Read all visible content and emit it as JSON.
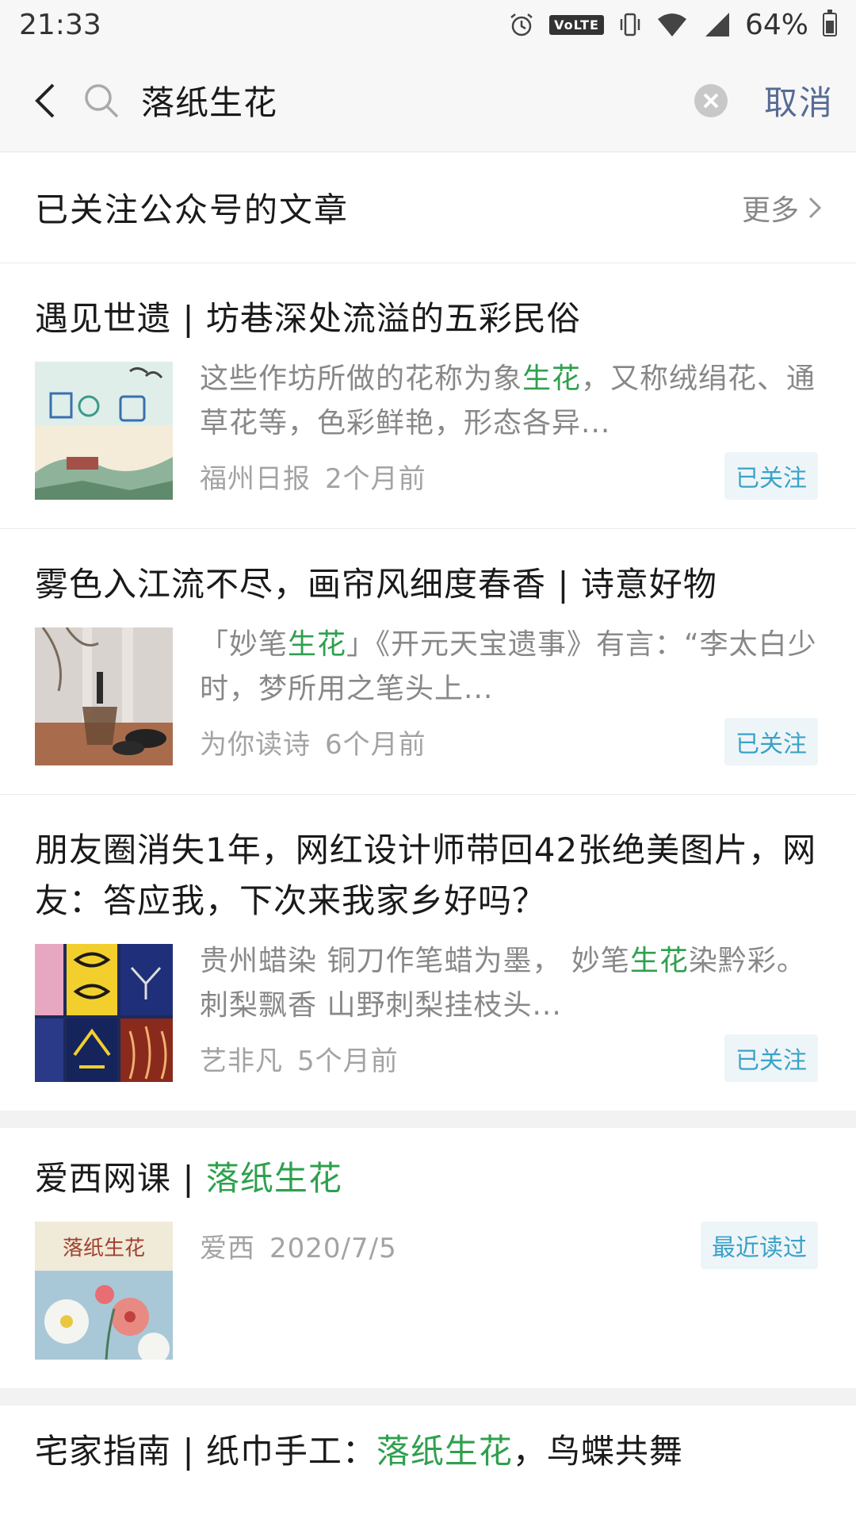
{
  "status_bar": {
    "time": "21:33",
    "volte": "VoLTE",
    "battery": "64%"
  },
  "search": {
    "query": "落纸生花",
    "cancel_label": "取消"
  },
  "section": {
    "title": "已关注公众号的文章",
    "more_label": "更多"
  },
  "articles": [
    {
      "title": "遇见世遗 | 坊巷深处流溢的五彩民俗",
      "excerpt_before": "这些作坊所做的花称为象",
      "excerpt_highlight": "生花",
      "excerpt_after": "，又称绒绢花、通草花等，色彩鲜艳，形态各异...",
      "source": "福州日报",
      "time": "2个月前",
      "tag": "已关注"
    },
    {
      "title": "雾色入江流不尽，画帘风细度春香 | 诗意好物",
      "excerpt_before": "「妙笔",
      "excerpt_highlight": "生花",
      "excerpt_after": "」《开元天宝遗事》有言：“李太白少时，梦所用之笔头上...",
      "source": "为你读诗",
      "time": "6个月前",
      "tag": "已关注"
    },
    {
      "title": "朋友圈消失1年，网红设计师带回42张绝美图片，网友：答应我，下次来我家乡好吗？",
      "excerpt_before": "贵州蜡染 铜刀作笔蜡为墨， 妙笔",
      "excerpt_highlight": "生花",
      "excerpt_after": "染黔彩。 刺梨飘香 山野刺梨挂枝头...",
      "source": "艺非凡",
      "time": "5个月前",
      "tag": "已关注"
    }
  ],
  "topic": {
    "title_prefix": "爱西网课 | ",
    "title_highlight": "落纸生花",
    "source": "爱西",
    "date": "2020/7/5",
    "tag": "最近读过",
    "thumb_text": "落纸生花"
  },
  "bottom_article": {
    "title_prefix": "宅家指南 | 纸巾手工：",
    "title_highlight": "落纸生花",
    "title_suffix": "，鸟蝶共舞"
  },
  "colors": {
    "highlight": "#2fa04e",
    "link": "#576b95",
    "tag_text": "#3aa2c8",
    "tag_bg": "#eef5f8"
  },
  "icons": [
    "back-icon",
    "search-icon",
    "clear-icon",
    "chevron-right-icon",
    "alarm-icon",
    "vibrate-icon",
    "wifi-icon",
    "signal-icon",
    "battery-icon"
  ]
}
